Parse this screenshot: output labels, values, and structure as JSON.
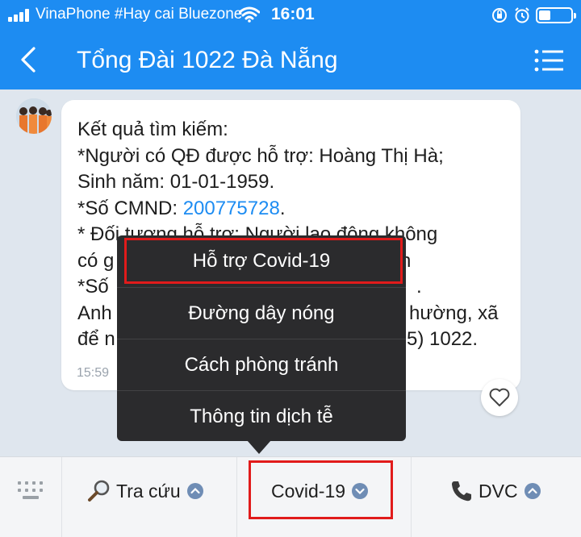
{
  "status_bar": {
    "carrier": "VinaPhone #Hay cai Bluezone",
    "time": "16:01"
  },
  "header": {
    "title": "Tổng Đài 1022 Đà Nẵng",
    "back_icon": "chevron-left-icon",
    "menu_icon": "list-menu-icon"
  },
  "message": {
    "line1": "Kết quả tìm kiếm:",
    "line2": "*Người có QĐ được hỗ trợ: Hoàng Thị Hà;",
    "line3": "Sinh năm: 01-01-1959.",
    "line4_prefix": "*Số CMND: ",
    "line4_link": "200775728",
    "line4_suffix": ".",
    "line5": "* Đối tượng hỗ trợ: Người lao động không",
    "line6": "có g",
    "line6_tail": "h",
    "line7": "*Số",
    "line7_tail": ".",
    "line8": "Anh",
    "line8_tail": "hường, xã",
    "line9": "để n",
    "line9_tail": "5) 1022.",
    "time": "15:59"
  },
  "popup_menu": {
    "items": [
      {
        "label": "Hỗ trợ Covid-19"
      },
      {
        "label": "Đường dây nóng"
      },
      {
        "label": "Cách phòng tránh"
      },
      {
        "label": "Thông tin dịch tễ"
      }
    ]
  },
  "bottom_bar": {
    "buttons": [
      {
        "label": "Tra cứu",
        "icon": "magnifier-icon"
      },
      {
        "label": "Covid-19",
        "icon": ""
      },
      {
        "label": "DVC",
        "icon": "phone-icon"
      }
    ]
  },
  "colors": {
    "header_blue": "#1d8cf2",
    "highlight_red": "#e11b1b",
    "popup_dark": "#2b2b2d",
    "link_blue": "#1d8cf2"
  }
}
